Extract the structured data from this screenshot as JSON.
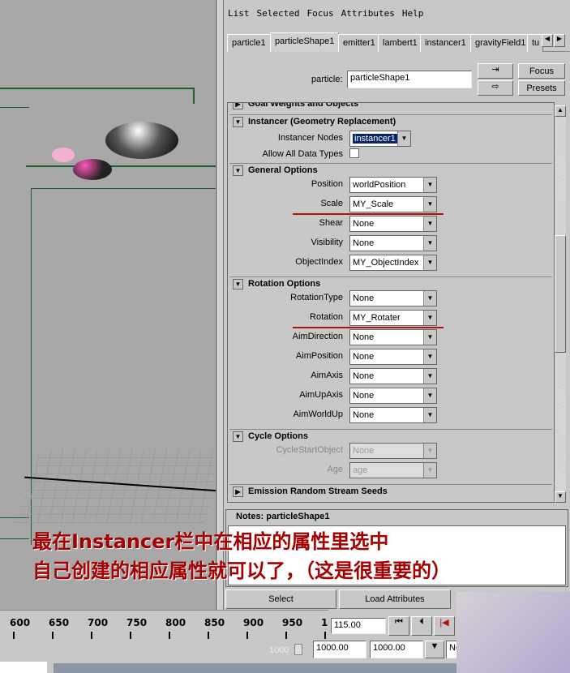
{
  "menu": [
    "List",
    "Selected",
    "Focus",
    "Attributes",
    "Help"
  ],
  "tabs": [
    "particle1",
    "particleShape1",
    "emitter1",
    "lambert1",
    "instancer1",
    "gravityField1",
    "tu"
  ],
  "active_tab": "particleShape1",
  "node_label": "particle:",
  "node_value": "particleShape1",
  "buttons": {
    "focus": "Focus",
    "presets": "Presets",
    "select": "Select",
    "load": "Load Attributes"
  },
  "sections": {
    "goal": "Goal Weights and Objects",
    "instancer": "Instancer (Geometry Replacement)",
    "general": "General Options",
    "rotation": "Rotation Options",
    "cycle": "Cycle Options",
    "emission": "Emission Random Stream Seeds"
  },
  "instancer_nodes": {
    "label": "Instancer Nodes",
    "value": "instancer1"
  },
  "allow_all": {
    "label": "Allow All Data Types",
    "checked": false
  },
  "general": [
    {
      "label": "Position",
      "value": "worldPosition"
    },
    {
      "label": "Scale",
      "value": "MY_Scale"
    },
    {
      "label": "Shear",
      "value": "None"
    },
    {
      "label": "Visibility",
      "value": "None"
    },
    {
      "label": "ObjectIndex",
      "value": "MY_ObjectIndex"
    }
  ],
  "rotation": [
    {
      "label": "RotationType",
      "value": "None"
    },
    {
      "label": "Rotation",
      "value": "MY_Rotater"
    },
    {
      "label": "AimDirection",
      "value": "None"
    },
    {
      "label": "AimPosition",
      "value": "None"
    },
    {
      "label": "AimAxis",
      "value": "None"
    },
    {
      "label": "AimUpAxis",
      "value": "None"
    },
    {
      "label": "AimWorldUp",
      "value": "None"
    }
  ],
  "cycle": [
    {
      "label": "CycleStartObject",
      "value": "None"
    },
    {
      "label": "Age",
      "value": "age"
    }
  ],
  "notes_title": "Notes: particleShape1",
  "annotation": [
    "最在Instancer栏中在相应的属性里选中",
    "自己创建的相应属性就可以了，（这是很重要的）"
  ],
  "timeline": {
    "ticks": [
      "600",
      "650",
      "700",
      "750",
      "800",
      "850",
      "900",
      "950",
      "1"
    ],
    "current": "115.00",
    "range_label": "1000",
    "start": "1000.00",
    "end": "1000.00",
    "extra": "No"
  },
  "highlight_color": "#b01010"
}
